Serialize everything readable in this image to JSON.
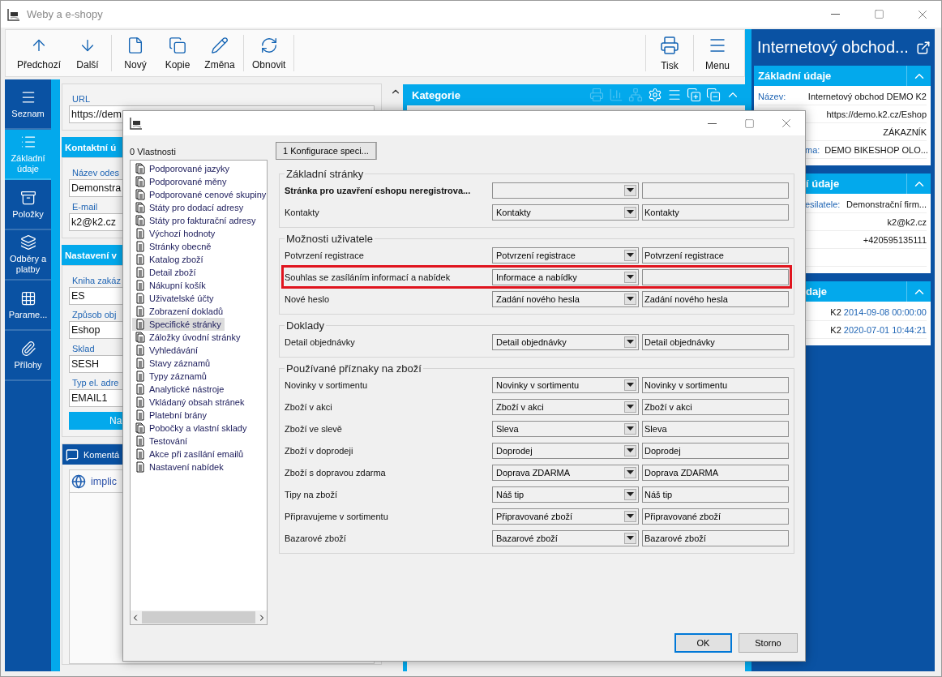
{
  "window": {
    "title": "Weby a e-shopy"
  },
  "toolbar": {
    "groups": [
      [
        {
          "kind": "up",
          "label": "Předchozí"
        },
        {
          "kind": "down",
          "label": "Další"
        }
      ],
      [
        {
          "kind": "new",
          "label": "Nový"
        },
        {
          "kind": "copy",
          "label": "Kopie"
        },
        {
          "kind": "edit",
          "label": "Změna"
        }
      ],
      [
        {
          "kind": "refresh",
          "label": "Obnovit"
        }
      ]
    ],
    "right": [
      {
        "kind": "print",
        "label": "Tisk"
      },
      {
        "kind": "menu",
        "label": "Menu"
      }
    ]
  },
  "nav": [
    {
      "kind": "list",
      "label": "Seznam",
      "selected": false
    },
    {
      "kind": "details",
      "label": "Základní údaje",
      "selected": true
    },
    {
      "kind": "box",
      "label": "Položky",
      "selected": false
    },
    {
      "kind": "layers",
      "label": "Odběry a platby",
      "selected": false
    },
    {
      "kind": "grid",
      "label": "Parame...",
      "selected": false
    },
    {
      "kind": "clip",
      "label": "Přílohy",
      "selected": false
    }
  ],
  "form": {
    "url_label": "URL",
    "url_value": "https://dem",
    "sections": [
      {
        "title": "Kontaktní ú",
        "fields": [
          {
            "label": "Název odes",
            "value": "Demonstra"
          },
          {
            "label": "E-mail",
            "value": "k2@k2.cz"
          }
        ]
      },
      {
        "title": "Nastavení v",
        "fields": [
          {
            "label": "Kniha zakáz",
            "value": "ES"
          },
          {
            "label": "Způsob obj",
            "value": "Eshop"
          },
          {
            "label": "Sklad",
            "value": "SESH"
          },
          {
            "label": "Typ el. adre",
            "value": "EMAIL1"
          }
        ],
        "button": "Na"
      }
    ]
  },
  "comments": {
    "title": "Komentá",
    "items": [
      {
        "text": "implic"
      }
    ]
  },
  "category_panel": {
    "title": "Kategorie",
    "tools": [
      {
        "kind": "print",
        "disabled": true
      },
      {
        "kind": "chart",
        "disabled": true
      },
      {
        "kind": "tree",
        "disabled": true
      },
      {
        "kind": "gear",
        "disabled": false
      },
      {
        "kind": "menu",
        "disabled": false
      },
      {
        "kind": "add",
        "disabled": false
      },
      {
        "kind": "remove",
        "disabled": false
      },
      {
        "kind": "collapse",
        "disabled": false
      }
    ]
  },
  "detail_panel": {
    "title": "Internetový obchod...",
    "sections": [
      {
        "title": "Základní údaje",
        "rows": [
          {
            "label": "Název:",
            "value": "Internetový obchod DEMO K2"
          },
          {
            "value": "https://demo.k2.cz/Eshop"
          },
          {
            "value": "ZÁKAZNÍK"
          },
          {
            "label": "ma:",
            "value": "DEMO BIKESHOP OLO..."
          }
        ]
      },
      {
        "title": "í údaje",
        "rows": [
          {
            "label": "esilatele:",
            "value": "Demonstrační firm..."
          },
          {
            "value": "k2@k2.cz"
          },
          {
            "value": "+420595135111"
          }
        ]
      },
      {
        "title": "daje",
        "rows": [
          {
            "value": "K2",
            "date": "2014-09-08 00:00:00"
          },
          {
            "value": "K2",
            "date": "2020-07-01 10:44:21"
          }
        ]
      }
    ]
  },
  "dialog": {
    "tree_label": "0 Vlastnosti",
    "items": [
      {
        "label": "Podporované jazyky",
        "kind": "multi",
        "selected": false
      },
      {
        "label": "Podporované měny",
        "kind": "multi",
        "selected": false
      },
      {
        "label": "Podporované cenové skupiny",
        "kind": "multi",
        "selected": false
      },
      {
        "label": "Státy pro dodací adresy",
        "kind": "multi",
        "selected": false
      },
      {
        "label": "Státy pro fakturační adresy",
        "kind": "multi",
        "selected": false
      },
      {
        "label": "Výchozí hodnoty",
        "kind": "single",
        "selected": false
      },
      {
        "label": "Stránky obecně",
        "kind": "single",
        "selected": false
      },
      {
        "label": "Katalog zboží",
        "kind": "single",
        "selected": false
      },
      {
        "label": "Detail zboží",
        "kind": "single",
        "selected": false
      },
      {
        "label": "Nákupní košík",
        "kind": "single",
        "selected": false
      },
      {
        "label": "Uživatelské účty",
        "kind": "single",
        "selected": false
      },
      {
        "label": "Zobrazení dokladů",
        "kind": "single",
        "selected": false
      },
      {
        "label": "Specifické stránky",
        "kind": "single",
        "selected": true
      },
      {
        "label": "Záložky úvodní stránky",
        "kind": "multi",
        "selected": false
      },
      {
        "label": "Vyhledávání",
        "kind": "single",
        "selected": false
      },
      {
        "label": "Stavy záznamů",
        "kind": "single",
        "selected": false
      },
      {
        "label": "Typy záznamů",
        "kind": "single",
        "selected": false
      },
      {
        "label": "Analytické nástroje",
        "kind": "single",
        "selected": false
      },
      {
        "label": "Vkládaný obsah stránek",
        "kind": "single",
        "selected": false
      },
      {
        "label": "Platební brány",
        "kind": "single",
        "selected": false
      },
      {
        "label": "Pobočky a vlastní sklady",
        "kind": "multi",
        "selected": false
      },
      {
        "label": "Testování",
        "kind": "single",
        "selected": false
      },
      {
        "label": "Akce při zasílání emailů",
        "kind": "single",
        "selected": false
      },
      {
        "label": "Nastavení nabídek",
        "kind": "single",
        "selected": false
      }
    ],
    "tab": {
      "label": "1 Konfigurace speci...",
      "selected": true
    },
    "groups": [
      {
        "title": "Základní stránky",
        "rows": [
          {
            "label": "Stránka pro uzavření eshopu neregistrova...",
            "required": true,
            "highlighted": false
          },
          {
            "label": "Kontakty",
            "required": false,
            "combo": "Kontakty",
            "text": "Kontakty",
            "highlighted": false
          }
        ]
      },
      {
        "title": "Možnosti uživatele",
        "rows": [
          {
            "label": "Potvrzení registrace",
            "required": false,
            "combo": "Potvrzení registrace",
            "text": "Potvrzení registrace",
            "highlighted": false
          },
          {
            "label": "Souhlas se zasíláním informací a nabídek",
            "required": false,
            "combo": "Informace a nabídky",
            "highlighted": true
          },
          {
            "label": "Nové heslo",
            "required": false,
            "combo": "Zadání nového hesla",
            "text": "Zadání nového hesla",
            "highlighted": false
          }
        ]
      },
      {
        "title": "Doklady",
        "rows": [
          {
            "label": "Detail objednávky",
            "required": false,
            "combo": "Detail objednávky",
            "text": "Detail objednávky",
            "highlighted": false
          }
        ]
      },
      {
        "title": "Používané příznaky na zboží",
        "rows": [
          {
            "label": "Novinky v sortimentu",
            "required": false,
            "combo": "Novinky v sortimentu",
            "text": "Novinky v sortimentu",
            "highlighted": false
          },
          {
            "label": "Zboží v akci",
            "required": false,
            "combo": "Zboží v akci",
            "text": "Zboží v akci",
            "highlighted": false
          },
          {
            "label": "Zboží ve slevě",
            "required": false,
            "combo": "Sleva",
            "text": "Sleva",
            "highlighted": false
          },
          {
            "label": "Zboží v doprodeji",
            "required": false,
            "combo": "Doprodej",
            "text": "Doprodej",
            "highlighted": false
          },
          {
            "label": "Zboží s dopravou zdarma",
            "required": false,
            "combo": "Doprava ZDARMA",
            "text": "Doprava ZDARMA",
            "highlighted": false
          },
          {
            "label": "Tipy na zboží",
            "required": false,
            "combo": "Náš tip",
            "text": "Náš tip",
            "highlighted": false
          },
          {
            "label": "Připravujeme v sortimentu",
            "required": false,
            "combo": "Připravované zboží",
            "text": "Připravované zboží",
            "highlighted": false
          },
          {
            "label": "Bazarové zboží",
            "required": false,
            "combo": "Bazarové zboží",
            "text": "Bazarové zboží",
            "highlighted": false
          }
        ]
      }
    ],
    "buttons": [
      {
        "label": "OK",
        "default": true
      },
      {
        "label": "Storno",
        "default": false
      }
    ]
  }
}
